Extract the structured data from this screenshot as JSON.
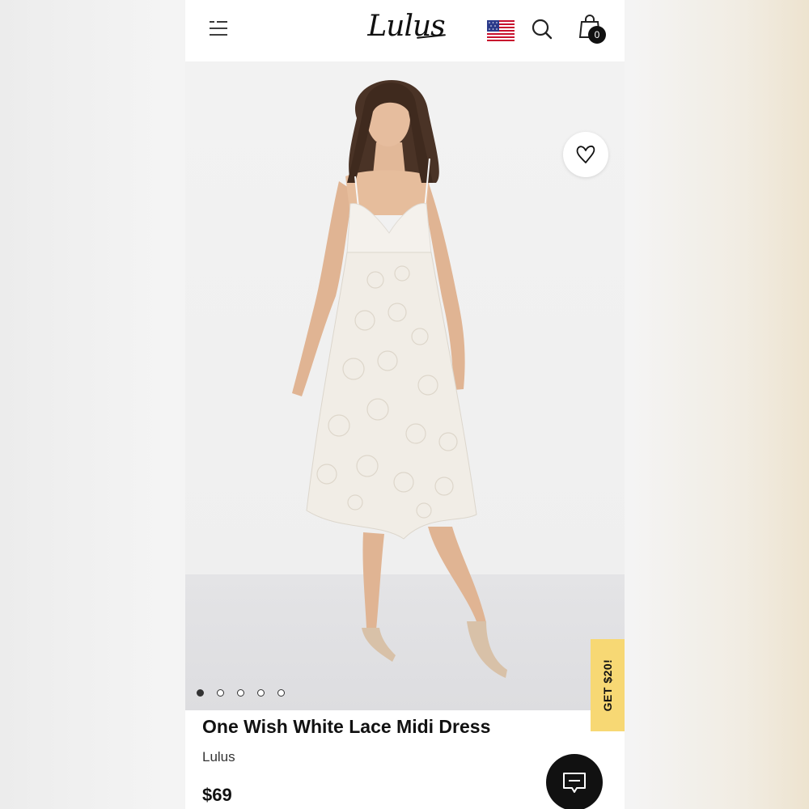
{
  "header": {
    "menu_icon": "hamburger-menu-icon",
    "logo_text": "Lulus",
    "flag_icon": "us-flag-icon",
    "search_icon": "search-icon",
    "bag_icon": "shopping-bag-icon",
    "bag_count": "0"
  },
  "gallery": {
    "wishlist_icon": "heart-icon",
    "slide_count": 5,
    "active_slide": 1
  },
  "promo": {
    "label": "GET $20!",
    "color": "#f7d874"
  },
  "product": {
    "title": "One Wish White Lace Midi Dress",
    "brand": "Lulus",
    "price": "$69"
  },
  "chat": {
    "icon": "chat-icon"
  }
}
